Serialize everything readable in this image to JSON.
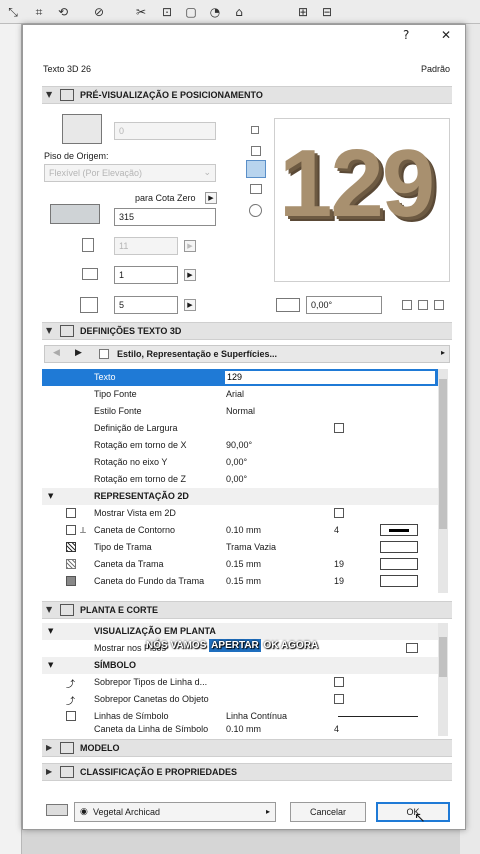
{
  "dialog": {
    "help_glyph": "?",
    "close_glyph": "✕",
    "object_title": "Texto 3D 26",
    "default_label": "Padrão"
  },
  "section_preview": {
    "title": "PRÉ-VISUALIZAÇÃO E POSICIONAMENTO",
    "value_top": "0",
    "origin_label": "Piso de Origem:",
    "origin_value": "Flexível (Por Elevação)",
    "cota_label": "para Cota Zero",
    "cota_value": "315",
    "val_11": "11",
    "val_1": "1",
    "val_5": "5",
    "preview_text": "129",
    "angle_value": "0,00°"
  },
  "section_settings": {
    "title": "DEFINIÇÕES TEXTO 3D",
    "nav_label": "Estilo, Representação e Superfícies...",
    "rows": [
      {
        "label": "Texto",
        "value": "129"
      },
      {
        "label": "Tipo Fonte",
        "value": "Arial"
      },
      {
        "label": "Estilo Fonte",
        "value": "Normal"
      },
      {
        "label": "Definição de Largura",
        "value": ""
      },
      {
        "label": "Rotação em torno de X",
        "value": "90,00°"
      },
      {
        "label": "Rotação no eixo Y",
        "value": "0,00°"
      },
      {
        "label": "Rotação em torno de Z",
        "value": "0,00°"
      }
    ],
    "rep2d_title": "REPRESENTAÇÃO 2D",
    "rep_rows": [
      {
        "label": "Mostrar Vista em 2D",
        "value": "",
        "num": ""
      },
      {
        "label": "Caneta de Contorno",
        "value": "0.10 mm",
        "num": "4"
      },
      {
        "label": "Tipo de Trama",
        "value": "Trama Vazia",
        "num": ""
      },
      {
        "label": "Caneta da Trama",
        "value": "0.15 mm",
        "num": "19"
      },
      {
        "label": "Caneta do Fundo da Trama",
        "value": "0.15 mm",
        "num": "19"
      }
    ]
  },
  "section_plan": {
    "title": "PLANTA E CORTE",
    "vis_title": "VISUALIZAÇÃO EM PLANTA",
    "show_label": "Mostrar nos Pisos",
    "symbol_title": "SÍMBOLO",
    "sym_rows": [
      {
        "label": "Sobrepor Tipos de Linha d...",
        "value": ""
      },
      {
        "label": "Sobrepor Canetas do Objeto",
        "value": ""
      },
      {
        "label": "Linhas de Símbolo",
        "value": "Linha Contínua"
      },
      {
        "label": "Caneta da Linha de Símbolo",
        "value": "0.10 mm"
      }
    ],
    "sym_last_num": "4"
  },
  "section_model": {
    "title": "MODELO"
  },
  "section_class": {
    "title": "CLASSIFICAÇÃO E PROPRIEDADES"
  },
  "footer": {
    "layer_value": "Vegetal Archicad",
    "cancel_label": "Cancelar",
    "ok_label": "OK"
  },
  "caption": {
    "part1": "NÓS VAMOS",
    "highlight": "APERTAR",
    "part2": "OK AGORA"
  },
  "colors": {
    "selection": "#1f7ad6",
    "preview_text": "#a8906f"
  }
}
